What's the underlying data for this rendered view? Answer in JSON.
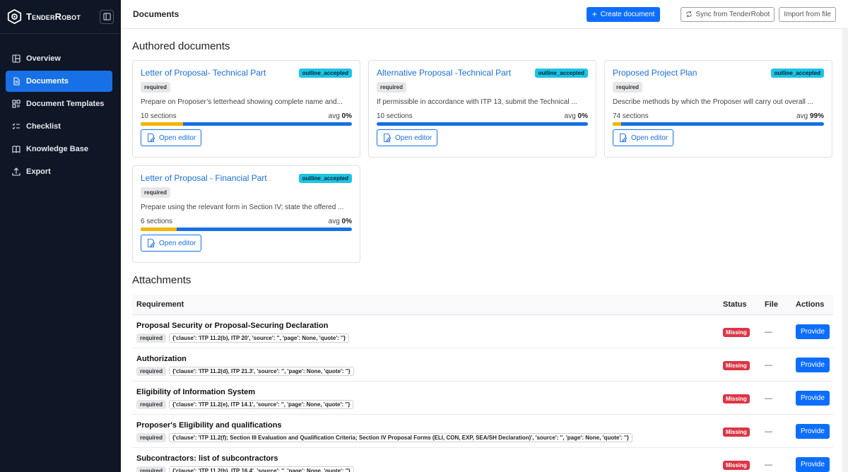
{
  "brand": {
    "name": "TenderRobot"
  },
  "sidebar": {
    "items": [
      {
        "label": "Overview",
        "icon": "layout-icon",
        "active": false
      },
      {
        "label": "Documents",
        "icon": "file-icon",
        "active": true
      },
      {
        "label": "Document Templates",
        "icon": "templates-icon",
        "active": false
      },
      {
        "label": "Checklist",
        "icon": "checklist-icon",
        "active": false
      },
      {
        "label": "Knowledge Base",
        "icon": "book-icon",
        "active": false
      },
      {
        "label": "Export",
        "icon": "export-icon",
        "active": false
      }
    ]
  },
  "header": {
    "title": "Documents",
    "create_label": "Create document",
    "sync_label": "Sync from TenderRobot",
    "import_label": "Import from file"
  },
  "authored": {
    "title": "Authored documents",
    "cards": [
      {
        "title": "Letter of Proposal- Technical Part",
        "badge": "outline_accepted",
        "tag": "required",
        "desc": "Prepare on Proposer’s letterhead showing complete name and...",
        "sections": "10 sections",
        "avg_label": "avg",
        "avg": "0%",
        "accepted_fraction": 0.2,
        "editor_label": "Open editor"
      },
      {
        "title": "Alternative Proposal -Technical Part",
        "badge": "outline_accepted",
        "tag": "required",
        "desc": "If permissible in accordance with ITP 13, submit the Technical ...",
        "sections": "10 sections",
        "avg_label": "avg",
        "avg": "0%",
        "accepted_fraction": 0.0,
        "editor_label": "Open editor"
      },
      {
        "title": "Proposed Project Plan",
        "badge": "outline_accepted",
        "tag": "required",
        "desc": "Describe methods by which the Proposer will carry out overall ...",
        "sections": "74 sections",
        "avg_label": "avg",
        "avg": "99%",
        "accepted_fraction": 0.04,
        "editor_label": "Open editor"
      },
      {
        "title": "Letter of Proposal - Financial Part",
        "badge": "outline_accepted",
        "tag": "required",
        "desc": "Prepare using the relevant form in Section IV; state the offered ...",
        "sections": "6 sections",
        "avg_label": "avg",
        "avg": "0%",
        "accepted_fraction": 0.17,
        "editor_label": "Open editor"
      }
    ]
  },
  "attachments": {
    "title": "Attachments",
    "columns": {
      "requirement": "Requirement",
      "status": "Status",
      "file": "File",
      "actions": "Actions"
    },
    "rows": [
      {
        "title": "Proposal Security or Proposal-Securing Declaration",
        "tag": "required",
        "meta": "{'clause': 'ITP 11.2(b), ITP 20', 'source': '', 'page': None, 'quote': ''}",
        "status": "Missing",
        "file": "—",
        "action": "Provide"
      },
      {
        "title": "Authorization",
        "tag": "required",
        "meta": "{'clause': 'ITP 11.2(d), ITP 21.3', 'source': '', 'page': None, 'quote': ''}",
        "status": "Missing",
        "file": "—",
        "action": "Provide"
      },
      {
        "title": "Eligibility of Information System",
        "tag": "required",
        "meta": "{'clause': 'ITP 11.2(e), ITP 14.1', 'source': '', 'page': None, 'quote': ''}",
        "status": "Missing",
        "file": "—",
        "action": "Provide"
      },
      {
        "title": "Proposer's Eligibility and qualifications",
        "tag": "required",
        "meta": "{'clause': 'ITP 11.2(f); Section III Evaluation and Qualification Criteria; Section IV Proposal Forms (ELI, CON, EXP, SEA/SH Declaration)', 'source': '', 'page': None, 'quote': ''}",
        "status": "Missing",
        "file": "—",
        "action": "Provide"
      },
      {
        "title": "Subcontractors: list of subcontractors",
        "tag": "required",
        "meta": "{'clause': 'ITP 11.2(h), ITP 16.4', 'source': '', 'page': None, 'quote': ''}",
        "status": "Missing",
        "file": "—",
        "action": "Provide"
      }
    ]
  },
  "colors": {
    "sidebar_bg": "#0f1625",
    "accent": "#1770e6",
    "badge": "#1cc4e6",
    "missing": "#dc3545",
    "progress_accepted": "#f4b400"
  }
}
